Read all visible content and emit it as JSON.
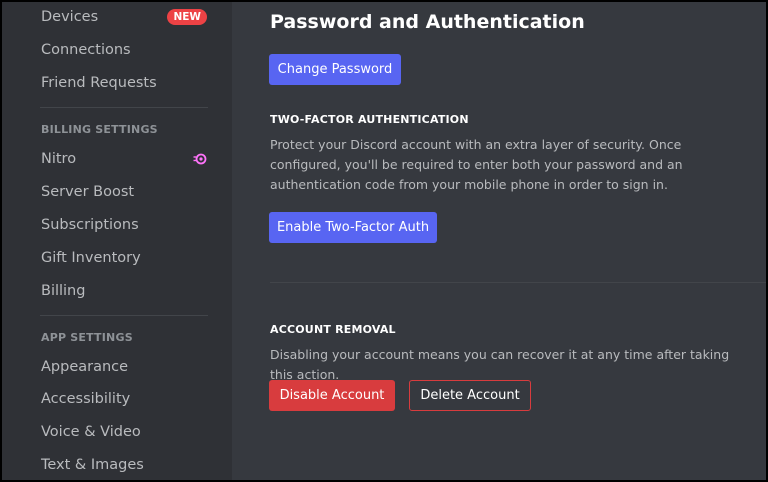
{
  "sidebar": {
    "items": [
      {
        "label": "Devices",
        "badge": "NEW"
      },
      {
        "label": "Connections"
      },
      {
        "label": "Friend Requests"
      },
      {
        "label": "Nitro",
        "icon": "nitro-icon"
      },
      {
        "label": "Server Boost"
      },
      {
        "label": "Subscriptions"
      },
      {
        "label": "Gift Inventory"
      },
      {
        "label": "Billing"
      },
      {
        "label": "Appearance"
      },
      {
        "label": "Accessibility"
      },
      {
        "label": "Voice & Video"
      },
      {
        "label": "Text & Images"
      }
    ],
    "billing_header": "BILLING SETTINGS",
    "app_header": "APP SETTINGS"
  },
  "main": {
    "title": "Password and Authentication",
    "change_password_label": "Change Password",
    "two_factor": {
      "header": "TWO-FACTOR AUTHENTICATION",
      "description": "Protect your Discord account with an extra layer of security. Once configured, you'll be required to enter both your password and an authentication code from your mobile phone in order to sign in.",
      "button_label": "Enable Two-Factor Auth"
    },
    "account_removal": {
      "header": "ACCOUNT REMOVAL",
      "description": "Disabling your account means you can recover it at any time after taking this action.",
      "disable_label": "Disable Account",
      "delete_label": "Delete Account"
    }
  },
  "colors": {
    "background": "#36393f",
    "sidebar": "#2f3136",
    "primary": "#5865f2",
    "danger": "#d83c3e",
    "badge": "#ed4245",
    "nitro": "#ff73fa"
  }
}
